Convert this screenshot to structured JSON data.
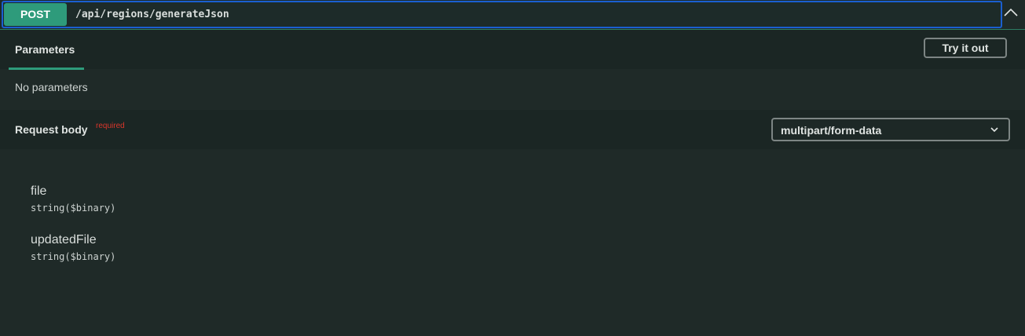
{
  "operation": {
    "method": "POST",
    "path": "/api/regions/generateJson"
  },
  "parameters": {
    "tab_label": "Parameters",
    "try_it_out_label": "Try it out",
    "empty_text": "No parameters"
  },
  "request_body": {
    "title": "Request body",
    "required_label": "required",
    "content_type": "multipart/form-data",
    "fields": [
      {
        "name": "file",
        "type": "string($binary)"
      },
      {
        "name": "updatedFile",
        "type": "string($binary)"
      }
    ]
  },
  "colors": {
    "method_post": "#2e9b7b",
    "focus_border": "#1a5fd0",
    "required": "#d9362b"
  },
  "icons": {
    "collapse": "chevron-up-icon",
    "select": "chevron-down-icon"
  }
}
